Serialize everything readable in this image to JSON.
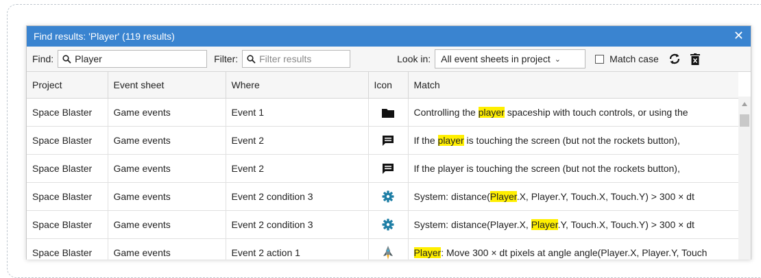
{
  "window": {
    "title": "Find results: 'Player' (119 results)",
    "close_glyph": "✕"
  },
  "toolbar": {
    "find_label": "Find:",
    "find_value": "Player",
    "filter_label": "Filter:",
    "filter_placeholder": "Filter results",
    "lookin_label": "Look in:",
    "lookin_value": "All event sheets in project",
    "match_case_label": "Match case",
    "match_case_checked": false,
    "refresh_icon": "refresh-icon",
    "clear_icon": "delete-icon"
  },
  "columns": [
    "Project",
    "Event sheet",
    "Where",
    "Icon",
    "Match"
  ],
  "rows": [
    {
      "project": "Space Blaster",
      "sheet": "Game events",
      "where": "Event 1",
      "icon": "folder-icon",
      "match": [
        [
          "Controlling the ",
          false
        ],
        [
          "player",
          true
        ],
        [
          " spaceship with touch controls, or using the",
          false
        ]
      ]
    },
    {
      "project": "Space Blaster",
      "sheet": "Game events",
      "where": "Event 2",
      "icon": "comment-icon",
      "match": [
        [
          "If the ",
          false
        ],
        [
          "player",
          true
        ],
        [
          " is touching the screen (but not the rockets button),",
          false
        ]
      ]
    },
    {
      "project": "Space Blaster",
      "sheet": "Game events",
      "where": "Event 2",
      "icon": "comment-icon",
      "match": [
        [
          "If the player is touching the screen (but not the rockets button),",
          false
        ]
      ]
    },
    {
      "project": "Space Blaster",
      "sheet": "Game events",
      "where": "Event 2 condition 3",
      "icon": "gear-icon",
      "match": [
        [
          "System: distance(",
          false
        ],
        [
          "Player",
          true
        ],
        [
          ".X, Player.Y, Touch.X, Touch.Y) > 300 × dt",
          false
        ]
      ]
    },
    {
      "project": "Space Blaster",
      "sheet": "Game events",
      "where": "Event 2 condition 3",
      "icon": "gear-icon",
      "match": [
        [
          "System: distance(Player.X, ",
          false
        ],
        [
          "Player",
          true
        ],
        [
          ".Y, Touch.X, Touch.Y) > 300 × dt",
          false
        ]
      ]
    },
    {
      "project": "Space Blaster",
      "sheet": "Game events",
      "where": "Event 2 action 1",
      "icon": "spaceship-icon",
      "match": [
        [
          "Player",
          true
        ],
        [
          ": Move 300 × dt pixels at angle angle(Player.X, Player.Y, Touch",
          false
        ]
      ]
    }
  ],
  "colors": {
    "titlebar": "#3a84d0",
    "highlight": "#ffef00",
    "gear": "#1f7fa6"
  }
}
